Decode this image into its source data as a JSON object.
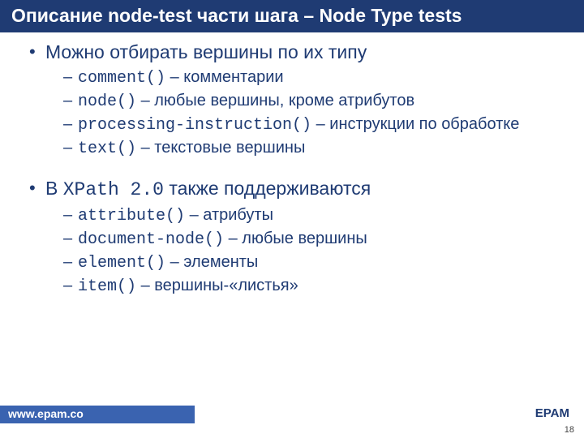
{
  "title": "Описание node-test части шага – Node Type tests",
  "section1": {
    "heading": "Можно отбирать вершины по их типу",
    "items": [
      {
        "code": "comment()",
        "sep": " – ",
        "desc": "комментарии"
      },
      {
        "code": "node()",
        "sep": " – ",
        "desc": "любые вершины, кроме атрибутов"
      },
      {
        "code": "processing-instruction()",
        "sep": " – ",
        "desc": "инструкции по обработке"
      },
      {
        "code": "text()",
        "sep": " – ",
        "desc": "текстовые вершины"
      }
    ]
  },
  "section2": {
    "heading_pre": "В ",
    "heading_code": "XPath 2.0",
    "heading_post": " также поддерживаются",
    "items": [
      {
        "code": "attribute()",
        "sep": " – ",
        "desc": "атрибуты"
      },
      {
        "code": "document-node()",
        "sep": " – ",
        "desc": "любые вершины"
      },
      {
        "code": "element()",
        "sep": " – ",
        "desc": "элементы"
      },
      {
        "code": "item()",
        "sep": " – ",
        "desc": "вершины-«листья»"
      }
    ]
  },
  "footer": {
    "url": "www.epam.co",
    "brand": "EPAM",
    "page": "18"
  }
}
